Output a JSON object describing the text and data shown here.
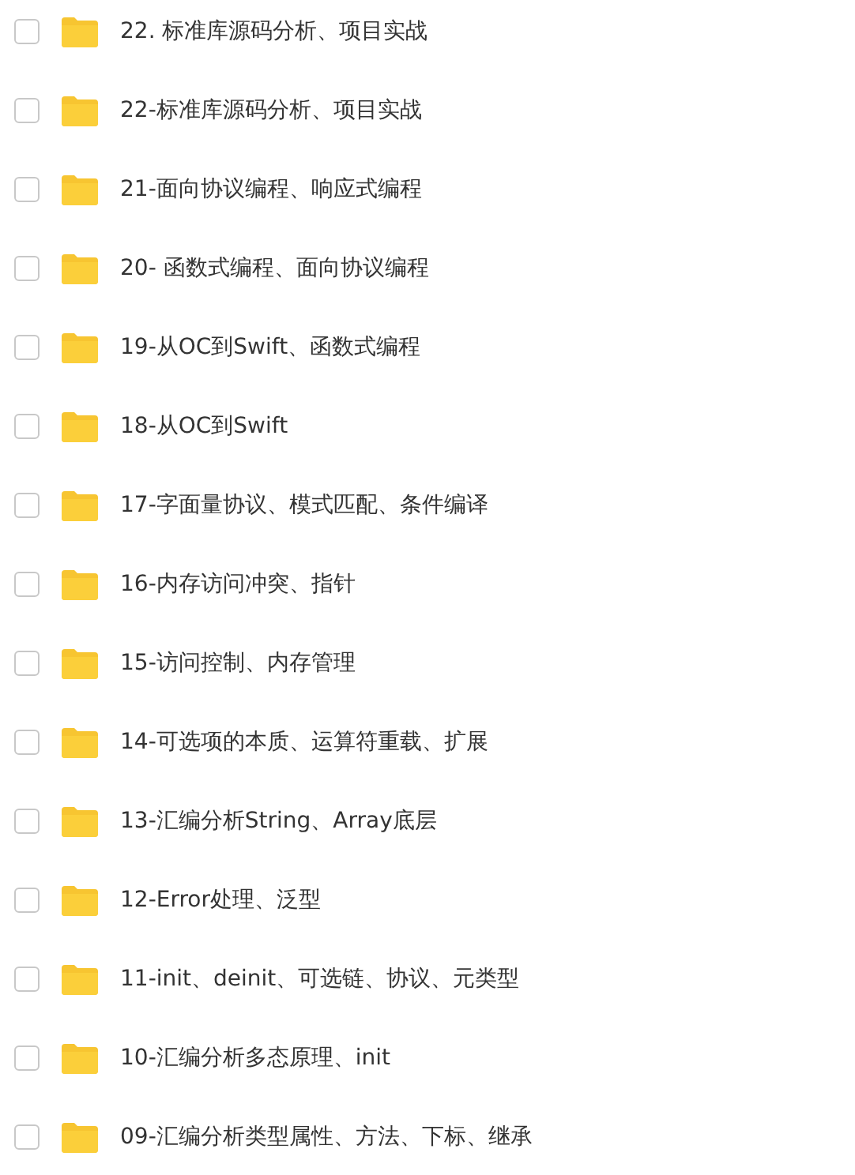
{
  "files": [
    {
      "name": "22. 标准库源码分析、项目实战",
      "checked": false
    },
    {
      "name": "22-标准库源码分析、项目实战",
      "checked": false
    },
    {
      "name": "21-面向协议编程、响应式编程",
      "checked": false
    },
    {
      "name": "20- 函数式编程、面向协议编程",
      "checked": false
    },
    {
      "name": "19-从OC到Swift、函数式编程",
      "checked": false
    },
    {
      "name": "18-从OC到Swift",
      "checked": false
    },
    {
      "name": "17-字面量协议、模式匹配、条件编译",
      "checked": false
    },
    {
      "name": "16-内存访问冲突、指针",
      "checked": false
    },
    {
      "name": "15-访问控制、内存管理",
      "checked": false
    },
    {
      "name": "14-可选项的本质、运算符重载、扩展",
      "checked": false
    },
    {
      "name": "13-汇编分析String、Array底层",
      "checked": false
    },
    {
      "name": "12-Error处理、泛型",
      "checked": false
    },
    {
      "name": "11-init、deinit、可选链、协议、元类型",
      "checked": false
    },
    {
      "name": "10-汇编分析多态原理、init",
      "checked": false
    },
    {
      "name": "09-汇编分析类型属性、方法、下标、继承",
      "checked": false
    }
  ]
}
